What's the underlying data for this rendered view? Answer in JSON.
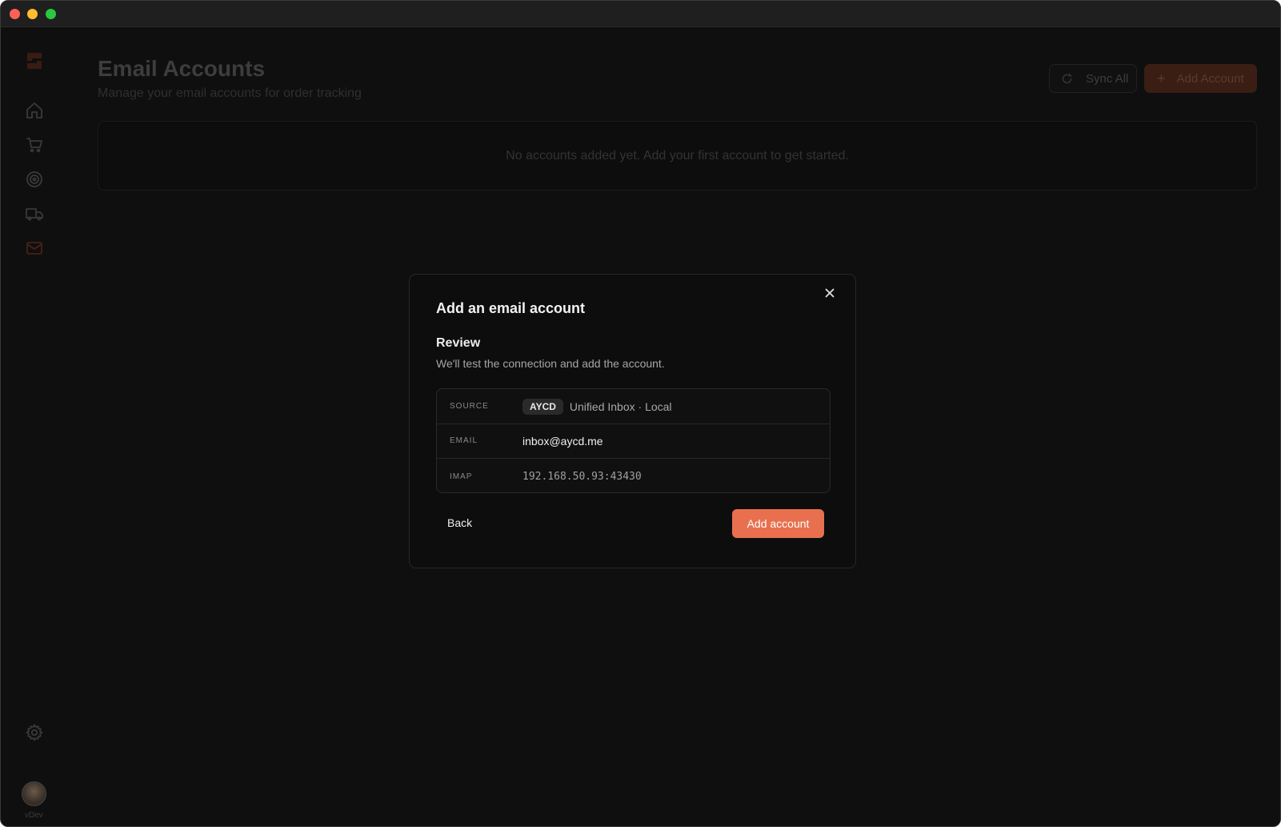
{
  "sidebar": {
    "items": [
      {
        "icon": "home-icon"
      },
      {
        "icon": "cart-icon"
      },
      {
        "icon": "target-icon"
      },
      {
        "icon": "truck-icon"
      },
      {
        "icon": "mail-icon"
      }
    ],
    "settings_icon": "gear-icon",
    "version": "vDev"
  },
  "header": {
    "title": "Email Accounts",
    "subtitle": "Manage your email accounts for order tracking",
    "sync_label": "Sync All",
    "add_label": "Add Account"
  },
  "empty_state": "No accounts added yet. Add your first account to get started.",
  "modal": {
    "title": "Add an email account",
    "step_title": "Review",
    "step_description": "We'll test the connection and add the account.",
    "rows": [
      {
        "label": "SOURCE",
        "badge": "AYCD",
        "value": "Unified Inbox · Local"
      },
      {
        "label": "EMAIL",
        "value": "inbox@aycd.me"
      },
      {
        "label": "IMAP",
        "value": "192.168.50.93:43430"
      }
    ],
    "back_label": "Back",
    "submit_label": "Add account"
  },
  "colors": {
    "accent": "#e8704f",
    "background": "#0f0f0f",
    "modal_background": "#0d0d0d"
  }
}
